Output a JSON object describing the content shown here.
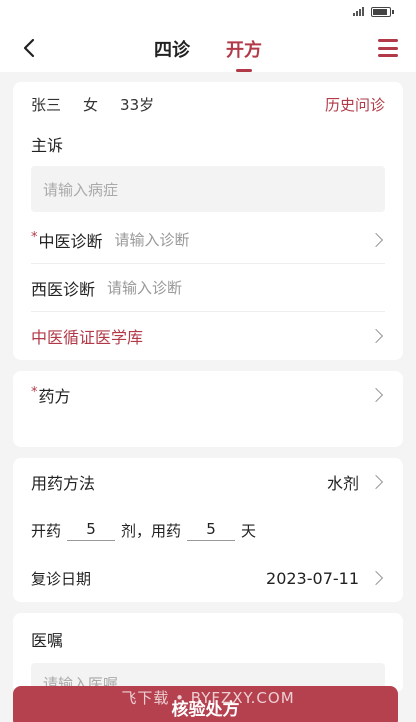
{
  "header": {
    "tabs": [
      {
        "label": "四诊",
        "active": false
      },
      {
        "label": "开方",
        "active": true
      }
    ]
  },
  "patient": {
    "name": "张三",
    "gender": "女",
    "age": "33岁",
    "history_link": "历史问诊"
  },
  "complaint": {
    "label": "主诉",
    "placeholder": "请输入病症"
  },
  "diagnosis": {
    "tcm_label": "中医诊断",
    "tcm_placeholder": "请输入诊断",
    "western_label": "西医诊断",
    "western_placeholder": "请输入诊断",
    "library_link": "中医循证医学库",
    "required_mark": "*"
  },
  "prescription": {
    "label": "药方",
    "required_mark": "*"
  },
  "usage": {
    "method_label": "用药方法",
    "method_value": "水剂",
    "open_label": "开药",
    "doses": "5",
    "doses_unit": "剂，用药",
    "days": "5",
    "days_unit": "天",
    "followup_label": "复诊日期",
    "followup_value": "2023-07-11"
  },
  "advice": {
    "label": "医嘱",
    "placeholder": "请输入医嘱"
  },
  "footer": {
    "submit_label": "核验处方",
    "watermark": "飞下载 • BYFZXY.COM"
  },
  "colors": {
    "accent": "#b23a48",
    "background": "#f4f4f4",
    "card": "#ffffff"
  }
}
